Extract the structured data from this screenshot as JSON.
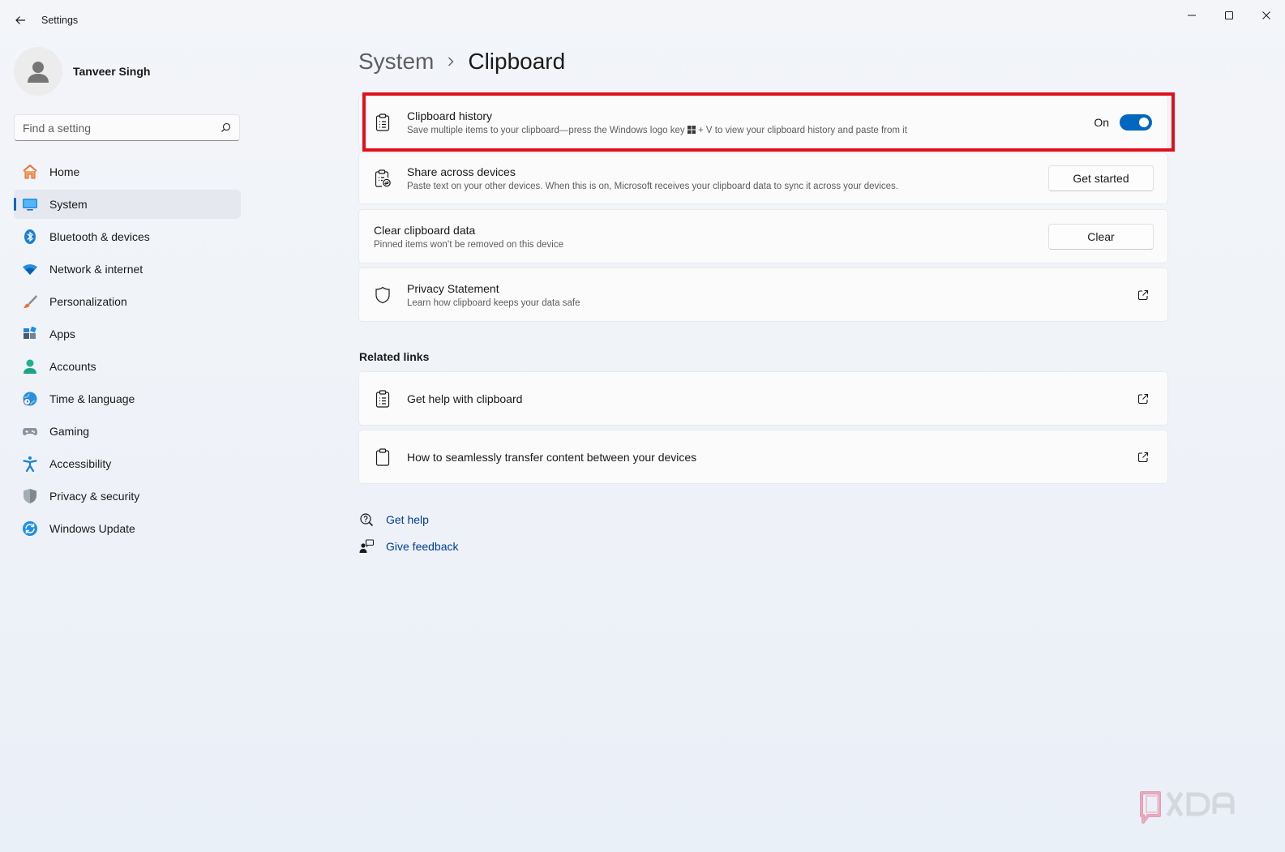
{
  "window": {
    "title": "Settings"
  },
  "profile": {
    "name": "Tanveer Singh"
  },
  "search": {
    "placeholder": "Find a setting"
  },
  "nav": {
    "items": [
      {
        "label": "Home",
        "icon": "home-icon"
      },
      {
        "label": "System",
        "icon": "system-icon",
        "active": true
      },
      {
        "label": "Bluetooth & devices",
        "icon": "bluetooth-icon"
      },
      {
        "label": "Network & internet",
        "icon": "wifi-icon"
      },
      {
        "label": "Personalization",
        "icon": "brush-icon"
      },
      {
        "label": "Apps",
        "icon": "apps-icon"
      },
      {
        "label": "Accounts",
        "icon": "accounts-icon"
      },
      {
        "label": "Time & language",
        "icon": "globe-clock-icon"
      },
      {
        "label": "Gaming",
        "icon": "gamepad-icon"
      },
      {
        "label": "Accessibility",
        "icon": "accessibility-icon"
      },
      {
        "label": "Privacy & security",
        "icon": "shield-icon"
      },
      {
        "label": "Windows Update",
        "icon": "update-icon"
      }
    ]
  },
  "breadcrumb": {
    "parent": "System",
    "current": "Clipboard"
  },
  "settings": {
    "clipboard_history": {
      "title": "Clipboard history",
      "desc_before": "Save multiple items to your clipboard—press the Windows logo key",
      "desc_after": "+ V to view your clipboard history and paste from it",
      "state_label": "On",
      "enabled": true
    },
    "share_across_devices": {
      "title": "Share across devices",
      "desc": "Paste text on your other devices. When this is on, Microsoft receives your clipboard data to sync it across your devices.",
      "button": "Get started"
    },
    "clear_data": {
      "title": "Clear clipboard data",
      "desc": "Pinned items won’t be removed on this device",
      "button": "Clear"
    },
    "privacy": {
      "title": "Privacy Statement",
      "desc": "Learn how clipboard keeps your data safe"
    }
  },
  "related_links": {
    "heading": "Related links",
    "items": [
      {
        "label": "Get help with clipboard"
      },
      {
        "label": "How to seamlessly transfer content between your devices"
      }
    ]
  },
  "help": {
    "get_help": "Get help",
    "give_feedback": "Give feedback"
  },
  "colors": {
    "accent": "#0067c0",
    "highlight_border": "#e0101d",
    "link": "#003e92"
  },
  "watermark": {
    "text": "XDA"
  }
}
